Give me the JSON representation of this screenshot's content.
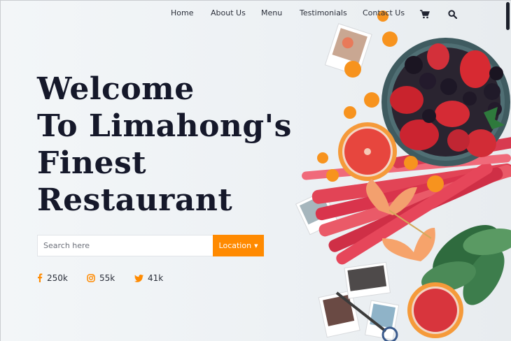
{
  "nav": {
    "items": [
      "Home",
      "About Us",
      "Menu",
      "Testimonials",
      "Contact Us"
    ],
    "cart_icon": "cart-icon",
    "search_icon": "search-icon"
  },
  "hero": {
    "title_lines": [
      "Welcome",
      "To Limahong's",
      "Finest",
      "Restaurant"
    ]
  },
  "search": {
    "placeholder": "Search here",
    "location_label": "Location"
  },
  "social": [
    {
      "icon": "facebook-icon",
      "count": "250k"
    },
    {
      "icon": "instagram-icon",
      "count": "55k"
    },
    {
      "icon": "twitter-icon",
      "count": "41k"
    }
  ],
  "colors": {
    "accent": "#ff8a00",
    "heading": "#15182a",
    "background": "#eef2f4"
  }
}
